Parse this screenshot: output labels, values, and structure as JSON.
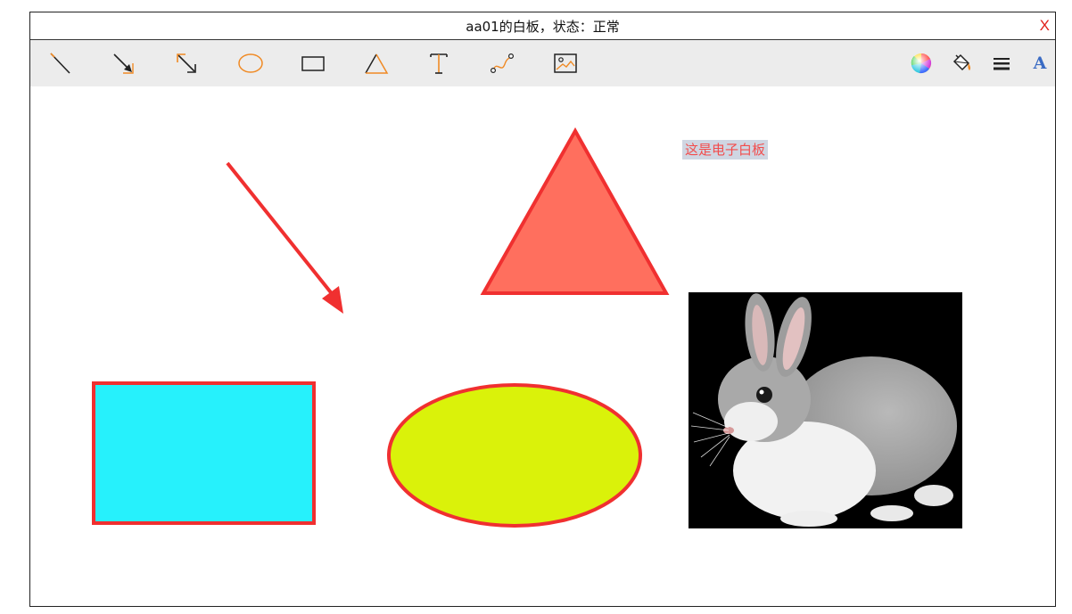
{
  "window": {
    "title": "aa01的白板，状态：正常",
    "close_label": "X"
  },
  "toolbar": {
    "tools_left": [
      "line-tool",
      "arrow-tool",
      "double-arrow-tool",
      "ellipse-tool",
      "rectangle-tool",
      "triangle-tool",
      "text-tool",
      "curve-tool",
      "image-tool"
    ],
    "tools_right": [
      "color-picker-tool",
      "fill-tool",
      "line-width-tool",
      "font-tool"
    ],
    "font_tool_glyph": "A"
  },
  "canvas": {
    "text_label": "这是电子白板",
    "shapes": [
      {
        "type": "arrow",
        "stroke": "#f03030"
      },
      {
        "type": "triangle",
        "fill": "#ff6f5e",
        "stroke": "#f03030"
      },
      {
        "type": "rectangle",
        "fill": "#26f1fc",
        "stroke": "#f03030"
      },
      {
        "type": "ellipse",
        "fill": "#daf20a",
        "stroke": "#f03030"
      },
      {
        "type": "image",
        "content": "rabbit"
      }
    ]
  },
  "colors": {
    "accent": "#f08a24",
    "stroke_red": "#f03030",
    "title_close": "#e0201a"
  }
}
